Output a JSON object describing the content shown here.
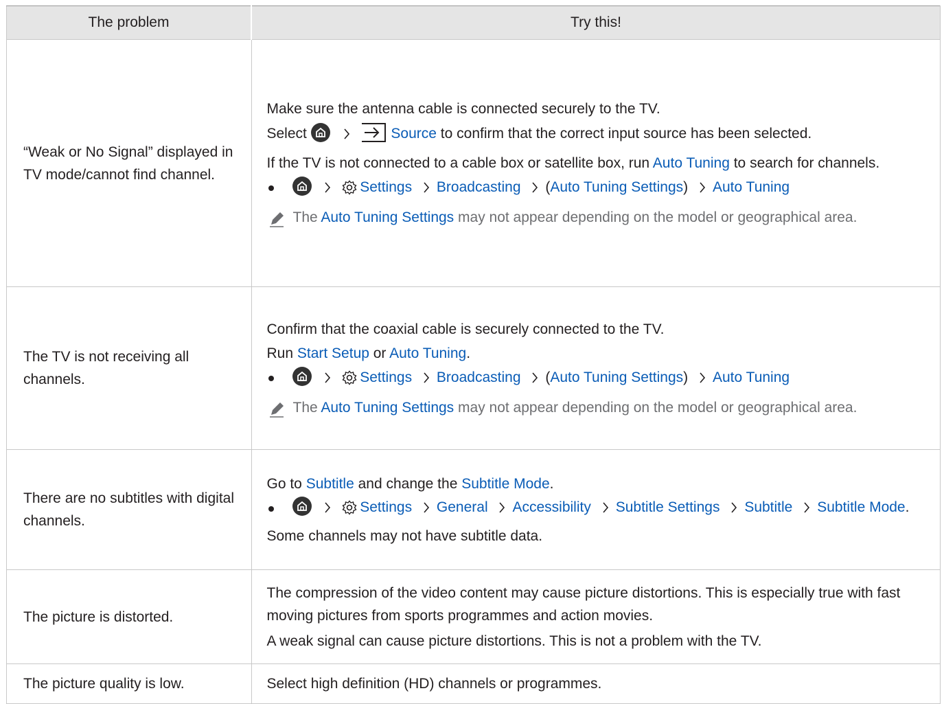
{
  "header": {
    "col1": "The problem",
    "col2": "Try this!"
  },
  "rows": [
    {
      "problem": "“Weak or No Signal” displayed in TV mode/cannot find channel.",
      "line1": "Make sure the antenna cable is connected securely to the TV.",
      "select_prefix": "Select",
      "source": "Source",
      "select_suffix": " to confirm that the correct input source has been selected.",
      "line3_prefix": "If the TV is not connected to a cable box or satellite box, run ",
      "auto_tuning": "Auto Tuning",
      "line3_suffix": " to search for channels.",
      "path": [
        "Settings",
        "Broadcasting",
        "Auto Tuning Settings",
        "Auto Tuning"
      ],
      "note_prefix": "The ",
      "note_link": "Auto Tuning Settings",
      "note_suffix": " may not appear depending on the model or geographical area."
    },
    {
      "problem": "The TV is not receiving all channels.",
      "line1": "Confirm that the coaxial cable is securely connected to the TV.",
      "run_prefix": "Run ",
      "start_setup": "Start Setup",
      "or": " or ",
      "auto_tuning": "Auto Tuning",
      "period": ".",
      "path": [
        "Settings",
        "Broadcasting",
        "Auto Tuning Settings",
        "Auto Tuning"
      ],
      "note_prefix": "The ",
      "note_link": "Auto Tuning Settings",
      "note_suffix": " may not appear depending on the model or geographical area."
    },
    {
      "problem": "There are no subtitles with digital channels.",
      "go_prefix": "Go to ",
      "subtitle": "Subtitle",
      "go_mid": " and change the ",
      "subtitle_mode": "Subtitle Mode",
      "period": ".",
      "path": [
        "Settings",
        "General",
        "Accessibility",
        "Subtitle Settings",
        "Subtitle",
        "Subtitle Mode"
      ],
      "line3": "Some channels may not have subtitle data."
    },
    {
      "problem": "The picture is distorted.",
      "line1": "The compression of the video content may cause picture distortions. This is especially true with fast moving pictures from sports programmes and action movies.",
      "line2": "A weak signal can cause picture distortions. This is not a problem with the TV."
    },
    {
      "problem": "The picture quality is low.",
      "line1": "Select high definition (HD) channels or programmes."
    }
  ],
  "icons": {
    "home": "home-icon",
    "settings": "gear-icon",
    "source": "source-input-icon",
    "chevron": "chevron-right-icon",
    "note": "pencil-note-icon"
  },
  "colors": {
    "link": "#0a5cb6",
    "header_bg": "#e5e5e5",
    "note_text": "#6d6e71"
  }
}
